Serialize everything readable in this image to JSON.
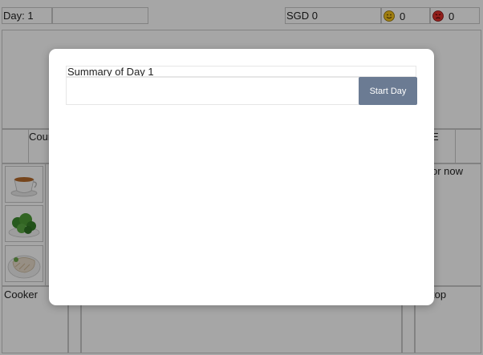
{
  "status_bar": {
    "day_label": "Day: 1",
    "money_label": "SGD 0",
    "happy_count": "0",
    "angry_count": "0"
  },
  "stations": {
    "counter_label": "Cour",
    "right_label": "E",
    "order_label": "or now",
    "cooker_label": "Cooker",
    "stop_label": "top"
  },
  "food_items": [
    {
      "name": "tea-cup-icon"
    },
    {
      "name": "broccoli-icon"
    },
    {
      "name": "chicken-dish-icon"
    }
  ],
  "modal": {
    "title": "Summary of Day 1",
    "input_value": "",
    "start_button_label": "Start Day"
  },
  "colors": {
    "button": "#6b7b93",
    "overlay": "rgba(0,0,0,0.35)",
    "happy": "#f4c21a",
    "angry": "#e0302a"
  }
}
